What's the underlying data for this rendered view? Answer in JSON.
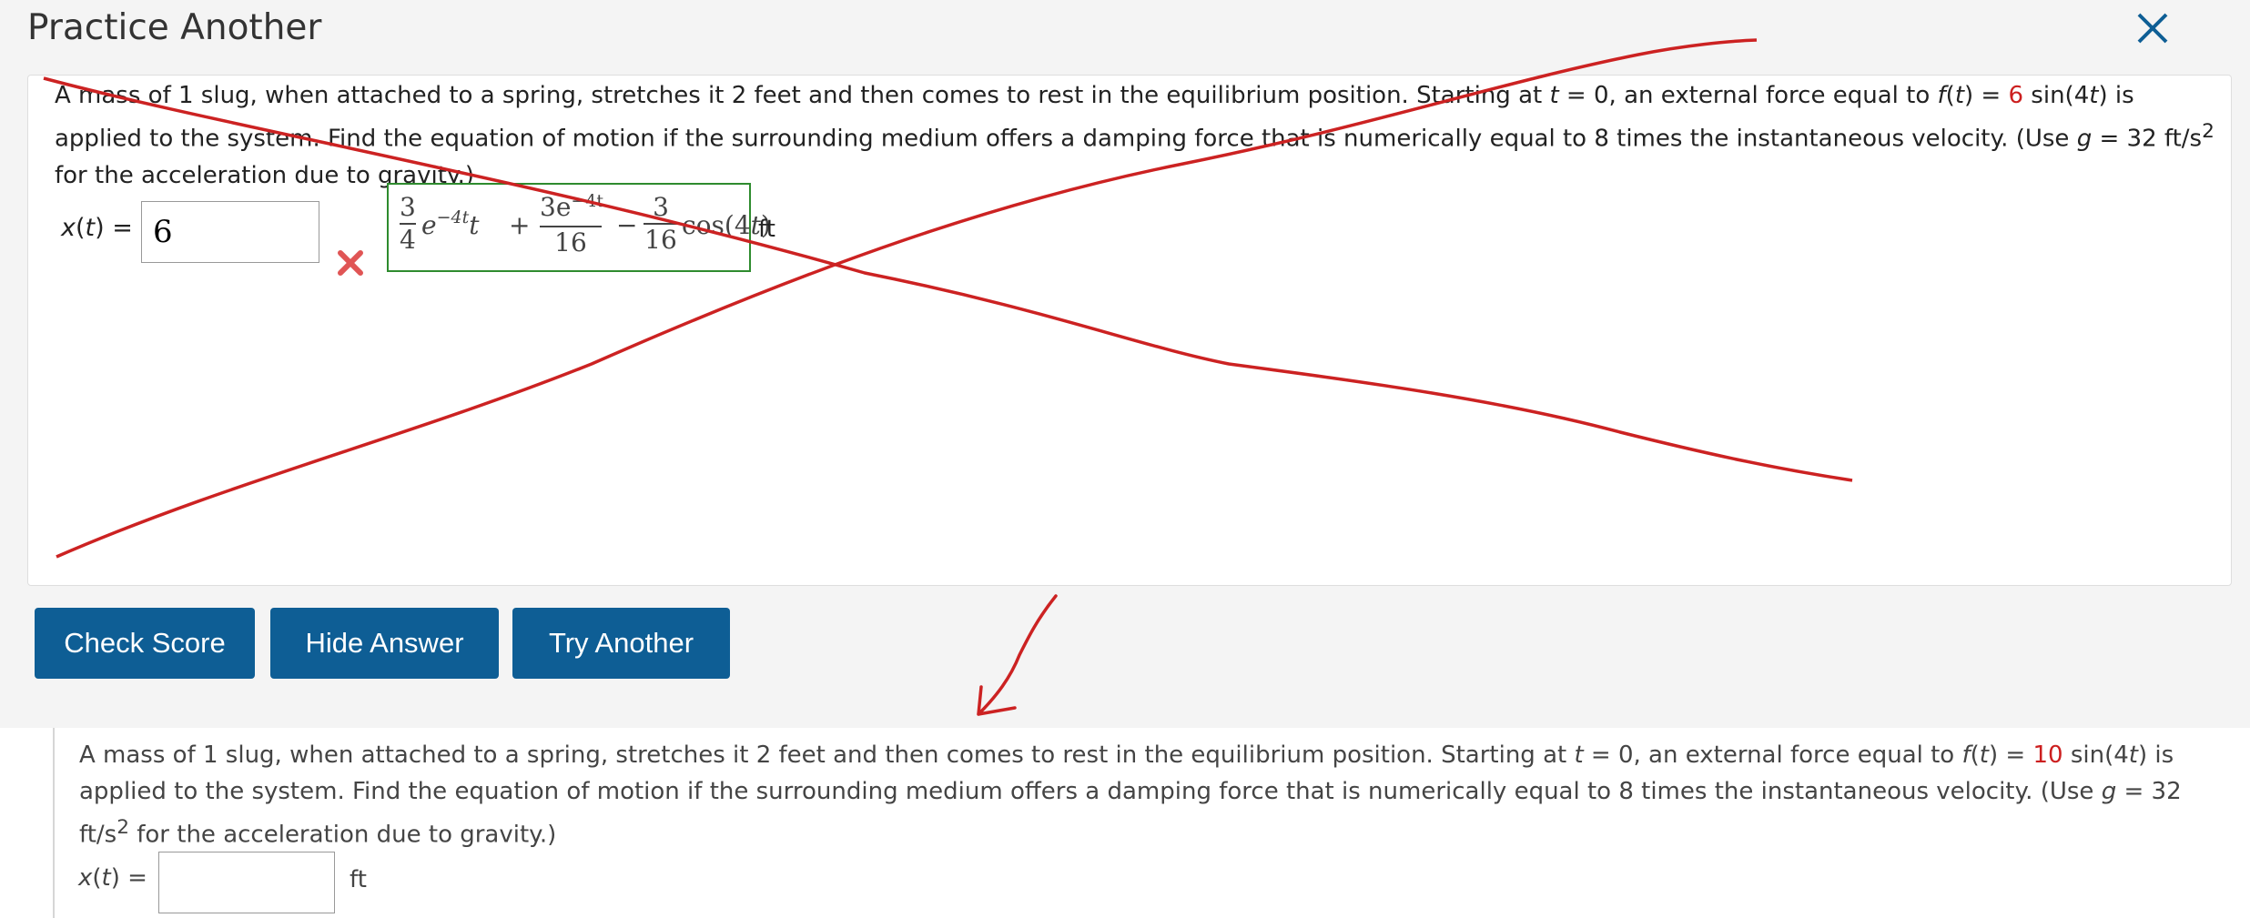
{
  "header": {
    "title": "Practice Another",
    "close_icon": "close-icon"
  },
  "question1": {
    "sentence_a": "A mass of 1 slug, when attached to a spring, stretches it 2 feet and then comes to rest in the equilibrium position. Starting at ",
    "t": "t",
    "t_eq": " = 0, ",
    "sentence_b": " an external force equal to ",
    "f": "f",
    "ft_paren_t": "t",
    "f_eq": ") = ",
    "force_value": "6",
    "sin": " sin(4",
    "sin_t": "t",
    "sentence_c": ")  is applied to the system. Find the equation of motion if the surrounding medium offers a damping force that is numerically equal to 8 times the instantaneous velocity. (Use ",
    "g": "g",
    "g_eq": " = 32 ft/s",
    "g_exp": "2",
    "sentence_d": "  for the acceleration due to gravity.)",
    "answer_label_x": "x",
    "answer_label_t": "t",
    "answer_value": "6",
    "unit": "ft",
    "result_icon": "wrong-x-icon",
    "correct_answer": {
      "f1_num": "3",
      "f1_den": "4",
      "e1": "e",
      "e1_exp": "−4t",
      "t1": "t",
      "plus": "+",
      "f2_num": "3e",
      "f2_num_exp": "−4t",
      "f2_den": "16",
      "minus": "−",
      "f3_num": "3",
      "f3_den": "16",
      "cos": "cos(4",
      "cos_t": "t",
      "cos_close": ")"
    }
  },
  "buttons": {
    "check_score": "Check Score",
    "hide_answer": "Hide Answer",
    "try_another": "Try Another"
  },
  "question2": {
    "sentence_a": "A mass of 1 slug, when attached to a spring, stretches it 2 feet and then comes to rest in the equilibrium position. Starting at ",
    "t": "t",
    "t_eq": " = 0, an external force equal to ",
    "f": "f",
    "ft_paren_t": "t",
    "f_eq": ") = ",
    "force_value": "10",
    "sin": " sin(4",
    "sin_t": "t",
    "sentence_c": ") is applied to the system. Find the equation of motion if the surrounding medium offers a damping force that is numerically equal to 8 times the instantaneous velocity. (Use ",
    "g": "g",
    "g_eq": " = 32 ft/s",
    "g_exp": "2",
    "sentence_d": " for the acceleration due to gravity.)",
    "answer_label_x": "x",
    "answer_label_t": "t",
    "answer_value": "",
    "unit": "ft"
  },
  "colors": {
    "button": "#0e5e95",
    "correct_border": "#2e8b2e",
    "force_value": "#cc1f1f",
    "annotation": "#cc2222",
    "close": "#0e5e95"
  }
}
